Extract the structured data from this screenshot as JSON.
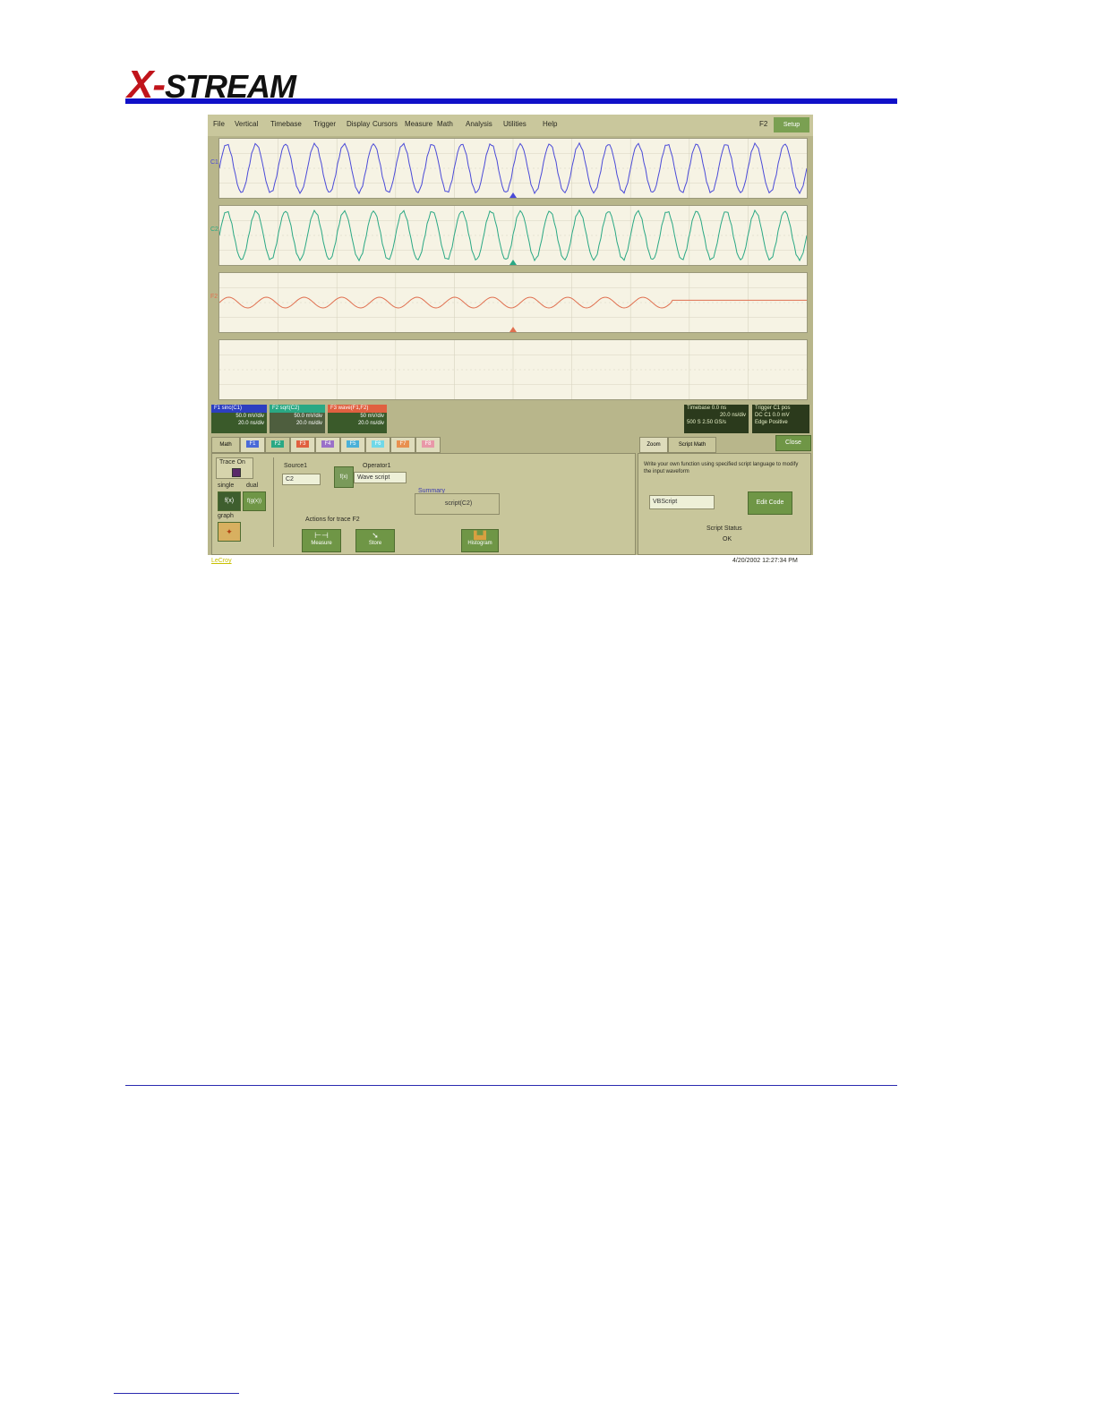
{
  "header": {
    "logo_text": "STREAM",
    "logo_x": "X-"
  },
  "scope": {
    "menu": [
      "File",
      "Vertical",
      "Timebase",
      "Trigger",
      "Display",
      "Cursors",
      "Measure",
      "Math",
      "Analysis",
      "Utilities",
      "Help"
    ],
    "menu_right": "F2",
    "setup_label": "Setup",
    "trace_labels": [
      "C1",
      "C2",
      "F2",
      ""
    ],
    "trace_colors": [
      "#4a4ad8",
      "#2aa884",
      "#e07050"
    ],
    "trace_boxes": [
      {
        "title": "F1   sinc(C1)",
        "lines": [
          "50.0 mV/div",
          "20.0 ns/div"
        ],
        "color": "#2d3fc0",
        "bg": "#3a5a2a"
      },
      {
        "title": "F2   sqrt(C2)",
        "lines": [
          "50.0 mV/div",
          "20.0 ns/div"
        ],
        "color": "#2aa884",
        "bg": "#5a6a4a"
      },
      {
        "title": "F3   wave(F1,F2)",
        "lines": [
          "50 mV/div",
          "20.0 ns/div"
        ],
        "color": "#e06040",
        "bg": "#3a5a2a"
      }
    ],
    "timebase_box": [
      "Timebase   0.0 ns",
      "20.0 ns/div",
      "500 S    2.50 GS/s"
    ],
    "trigger_box": [
      "Trigger   C1 pos",
      "DC   C1 0.0 mV",
      "Edge   Positive"
    ],
    "tabs": [
      "Math",
      "F1",
      "F2",
      "F3",
      "F4",
      "F5",
      "F6",
      "F7",
      "F8"
    ],
    "tab_colors": [
      "#c8c69b",
      "#4a6ad8",
      "#2aa884",
      "#e06040",
      "#9a70c8",
      "#4ab0d8",
      "#70d8e8",
      "#e89050",
      "#e898a8"
    ],
    "right_tabs": [
      "Zoom",
      "Script Math"
    ],
    "close_label": "Close",
    "trace_on_label": "Trace On",
    "single_label": "single",
    "dual_label": "dual",
    "graph_label": "graph",
    "source1_label": "Source1",
    "source1_value": "C2",
    "operator1_label": "Operator1",
    "operator1_value": "Wave script",
    "summary_label": "Summary",
    "summary_value": "script(C2)",
    "actions_label": "Actions for trace F2",
    "action_buttons": [
      "Measure",
      "Store",
      "Histogram"
    ],
    "script_help": "Write your own function using specified script language to modify the input waveform",
    "script_lang": "VBScript",
    "edit_code_label": "Edit Code",
    "script_status_label": "Script Status",
    "script_status_value": "OK",
    "brand_link": "LeCroy",
    "timestamp": "4/20/2002 12:27:34 PM"
  }
}
